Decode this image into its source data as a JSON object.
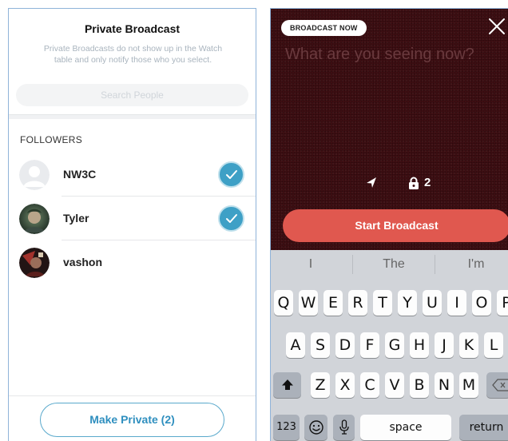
{
  "private_panel": {
    "title": "Private Broadcast",
    "description": "Private Broadcasts do not show up in the Watch table and only notify those who you select.",
    "search_placeholder": "Search People",
    "section_label": "FOLLOWERS",
    "followers": [
      {
        "name": "NW3C",
        "selected": true,
        "avatar": "default-avatar"
      },
      {
        "name": "Tyler",
        "selected": true,
        "avatar": "photo-avatar"
      },
      {
        "name": "vashon",
        "selected": false,
        "avatar": "photo-avatar"
      }
    ],
    "make_private_label": "Make Private (2)"
  },
  "broadcast_panel": {
    "badge": "BROADCAST NOW",
    "prompt_placeholder": "What are you seeing now?",
    "location_icon": "location-arrow-icon",
    "private_count": "2",
    "start_label": "Start Broadcast",
    "colors": {
      "background": "#3d0e12",
      "start_button": "#e0584f"
    }
  },
  "keyboard": {
    "suggestions": [
      "I",
      "The",
      "I'm"
    ],
    "row1": [
      "Q",
      "W",
      "E",
      "R",
      "T",
      "Y",
      "U",
      "I",
      "O",
      "P"
    ],
    "row2": [
      "A",
      "S",
      "D",
      "F",
      "G",
      "H",
      "J",
      "K",
      "L"
    ],
    "row3": [
      "Z",
      "X",
      "C",
      "V",
      "B",
      "N",
      "M"
    ],
    "numbers_key": "123",
    "space_key": "space",
    "return_key": "return"
  },
  "colors": {
    "accent": "#3ea0c6",
    "button_text": "#2f8fbf"
  }
}
